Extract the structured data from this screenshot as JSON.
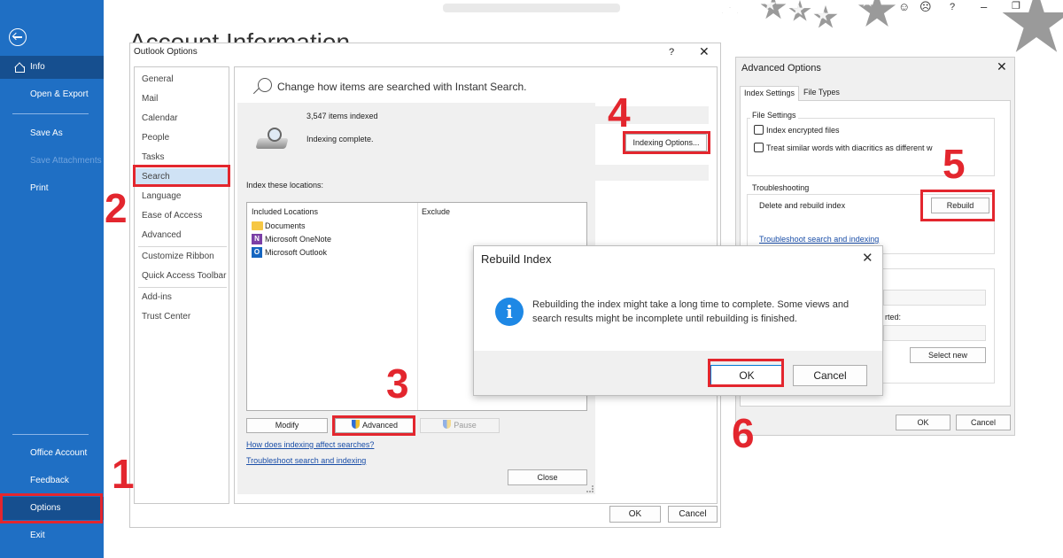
{
  "window": {
    "title_blurred": "",
    "help": "?",
    "minimize": "–",
    "restore": "❐",
    "emoji_happy": "☺",
    "emoji_sad": "☹"
  },
  "backstage": {
    "items": [
      {
        "label": "Info"
      },
      {
        "label": "Open & Export"
      },
      {
        "label": "Save As"
      },
      {
        "label": "Save Attachments"
      },
      {
        "label": "Print"
      },
      {
        "label": "Office Account"
      },
      {
        "label": "Feedback"
      },
      {
        "label": "Options"
      },
      {
        "label": "Exit"
      }
    ]
  },
  "page": {
    "heading": "Account Information"
  },
  "options_dialog": {
    "title": "Outlook Options",
    "help": "?",
    "close": "✕",
    "nav": [
      "General",
      "Mail",
      "Calendar",
      "People",
      "Tasks",
      "Search",
      "Language",
      "Ease of Access",
      "Advanced",
      "Customize Ribbon",
      "Quick Access Toolbar",
      "Add-ins",
      "Trust Center"
    ],
    "banner": "Change how items are searched with Instant Search.",
    "ok": "OK",
    "cancel": "Cancel"
  },
  "indexing": {
    "count": "3,547 items indexed",
    "status": "Indexing complete.",
    "index_label": "Index these locations:",
    "col_included": "Included Locations",
    "col_exclude": "Exclude",
    "locations": [
      "Documents",
      "Microsoft OneNote",
      "Microsoft Outlook"
    ],
    "modify": "Modify",
    "advanced": "Advanced",
    "pause": "Pause",
    "link_affect": "How does indexing affect searches?",
    "link_troubleshoot": "Troubleshoot search and indexing",
    "close": "Close",
    "options_button": "Indexing Options..."
  },
  "rebuild_dialog": {
    "title": "Rebuild Index",
    "close": "✕",
    "message": "Rebuilding the index might take a long time to complete. Some views and search results might be incomplete until rebuilding is finished.",
    "ok": "OK",
    "cancel": "Cancel"
  },
  "advanced_dialog": {
    "title": "Advanced Options",
    "close": "✕",
    "tab_index": "Index Settings",
    "tab_filetypes": "File Types",
    "file_settings": "File Settings",
    "chk_encrypted": "Index encrypted files",
    "chk_diacritics": "Treat similar words with diacritics as different w",
    "troubleshooting": "Troubleshooting",
    "delete_rebuild": "Delete and rebuild index",
    "rebuild": "Rebuild",
    "troubleshoot_link": "Troubleshoot search and indexing",
    "partial_text": "rted:",
    "select_new": "Select new",
    "ok": "OK",
    "cancel": "Cancel"
  },
  "steps": [
    "1",
    "2",
    "3",
    "4",
    "5",
    "6"
  ],
  "colors": {
    "accent": "#1f6fc4",
    "highlight": "#e3262e",
    "info": "#1e88e5"
  }
}
